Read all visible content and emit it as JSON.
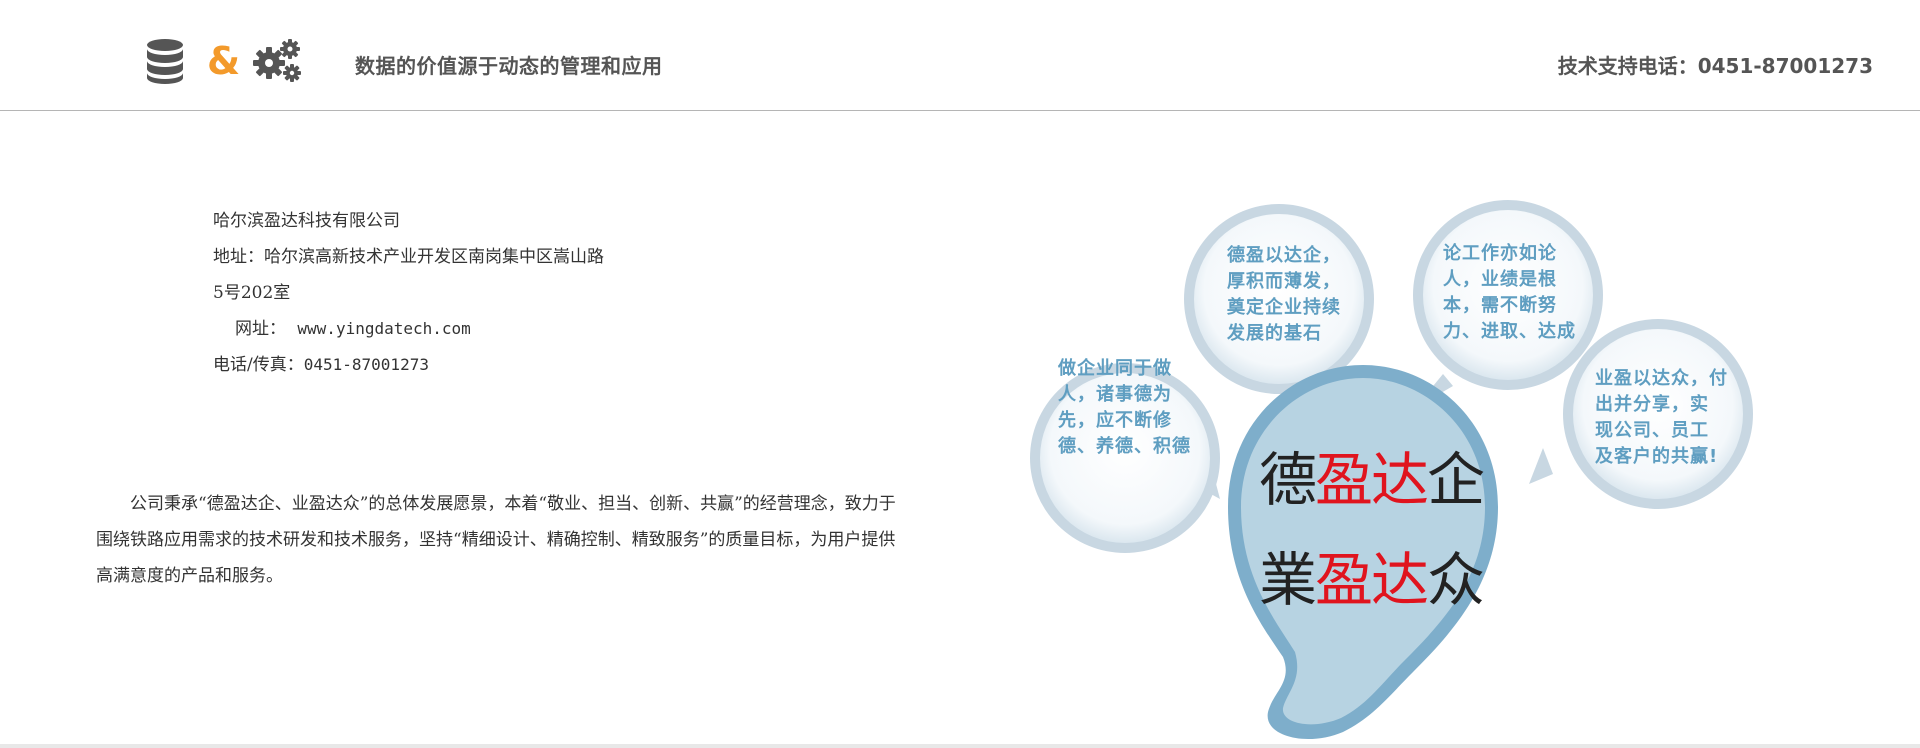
{
  "header": {
    "logo_amp": "&",
    "slogan": "数据的价值源于动态的管理和应用",
    "support": "技术支持电话：0451-87001273"
  },
  "company": {
    "name": "哈尔滨盈达科技有限公司",
    "address_1": "地址：哈尔滨高新技术产业开发区南岗集中区嵩山路",
    "address_2": "5号202室",
    "website_label": "网址：",
    "website": "www.yingdatech.com",
    "phone_label": "电话/传真：",
    "phone": "0451-87001273"
  },
  "intro": {
    "text": "公司秉承“德盈达企、业盈达众”的总体发展愿景，本着“敬业、担当、创新、共赢”的经营理念，致力于围绕铁路应用需求的技术研发和技术服务，坚持“精细设计、精确控制、精致服务”的质量目标，为用户提供高满意度的产品和服务。"
  },
  "illustration": {
    "bubble_top_left": [
      "德盈以达企，",
      "厚积而薄发，",
      "奠定企业持续",
      "发展的基石"
    ],
    "bubble_top_right": [
      "论工作亦如论",
      "人，业绩是根",
      "本，需不断努",
      "力、进取、达成"
    ],
    "bubble_left": [
      "做企业同于做",
      "人，诸事德为",
      "先，应不断修",
      "德、养德、积德"
    ],
    "bubble_right": [
      "业盈以达众，付",
      "出并分享，实",
      "现公司、员工",
      "及客户的共赢!"
    ],
    "calligraphy_1": [
      "德",
      "盈",
      "达",
      "企"
    ],
    "calligraphy_2": [
      "業",
      "盈",
      "达",
      "众"
    ]
  },
  "colors": {
    "accent": "#f39a2b",
    "icon_gray": "#555555",
    "bubble_blue": "#5f9ec1",
    "callig_red": "#e0141e"
  },
  "icons": [
    "database-icon",
    "gears-icon"
  ]
}
